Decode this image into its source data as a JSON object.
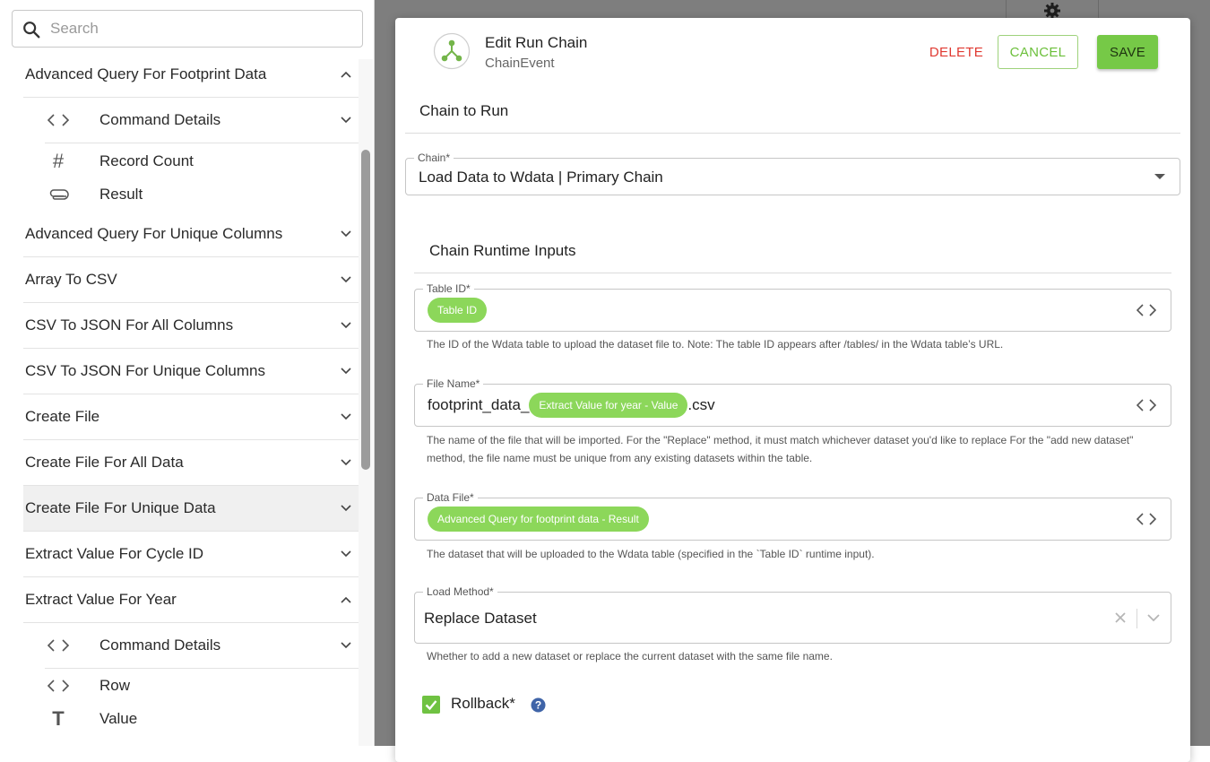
{
  "sidebar": {
    "search_placeholder": "Search",
    "items": [
      {
        "label": "Advanced Query For Footprint Data",
        "expanded": true
      },
      {
        "label": "Command Details",
        "icon": "code-icon",
        "sub": true
      },
      {
        "label": "Record Count",
        "icon": "hash-icon",
        "sub": true
      },
      {
        "label": "Result",
        "icon": "paperclip-icon",
        "sub": true
      },
      {
        "label": "Advanced Query For Unique Columns"
      },
      {
        "label": "Array To CSV"
      },
      {
        "label": "CSV To JSON For All Columns"
      },
      {
        "label": "CSV To JSON For Unique Columns"
      },
      {
        "label": "Create File"
      },
      {
        "label": "Create File For All Data"
      },
      {
        "label": "Create File For Unique Data",
        "selected": true
      },
      {
        "label": "Extract Value For Cycle ID"
      },
      {
        "label": "Extract Value For Year",
        "expanded": true
      },
      {
        "label": "Command Details",
        "icon": "code-icon",
        "sub": true
      },
      {
        "label": "Row",
        "icon": "code-icon",
        "sub": true
      },
      {
        "label": "Value",
        "icon": "text-type-icon",
        "sub": true
      }
    ]
  },
  "modal": {
    "title": "Edit Run Chain",
    "subtitle": "ChainEvent",
    "icon": "chain-node-icon",
    "delete_label": "DELETE",
    "cancel_label": "CANCEL",
    "save_label": "SAVE",
    "chain_section_title": "Chain to Run",
    "chain_field": {
      "label": "Chain*",
      "value": "Load Data to Wdata | Primary Chain"
    },
    "runtime_section_title": "Chain Runtime Inputs",
    "table_id": {
      "label": "Table ID*",
      "pill": "Table ID",
      "helper": "The ID of the Wdata table to upload the dataset file to. Note: The table ID appears after /tables/ in the Wdata table’s URL."
    },
    "file_name": {
      "label": "File Name*",
      "prefix": "footprint_data_",
      "pill": "Extract Value for year - Value",
      "suffix": ".csv",
      "helper_line1": "The name of the file that will be imported. For the \"Replace\" method, it must match whichever dataset you'd like to replace For the \"add new dataset\"",
      "helper_line2": "method, the file name must be unique from any existing datasets within the table."
    },
    "data_file": {
      "label": "Data File*",
      "pill": "Advanced Query for footprint data - Result",
      "helper": "The dataset that will be uploaded to the Wdata table (specified in the `Table ID` runtime input)."
    },
    "load_method": {
      "label": "Load Method*",
      "value": "Replace Dataset",
      "helper": "Whether to add a new dataset or replace the current dataset with the same file name."
    },
    "rollback": {
      "label": "Rollback*",
      "checked": true
    }
  },
  "colors": {
    "accent_green": "#76c947",
    "pill_green": "#8cd75a",
    "delete_red": "#e03a32",
    "backdrop": "#7e7e7e"
  }
}
